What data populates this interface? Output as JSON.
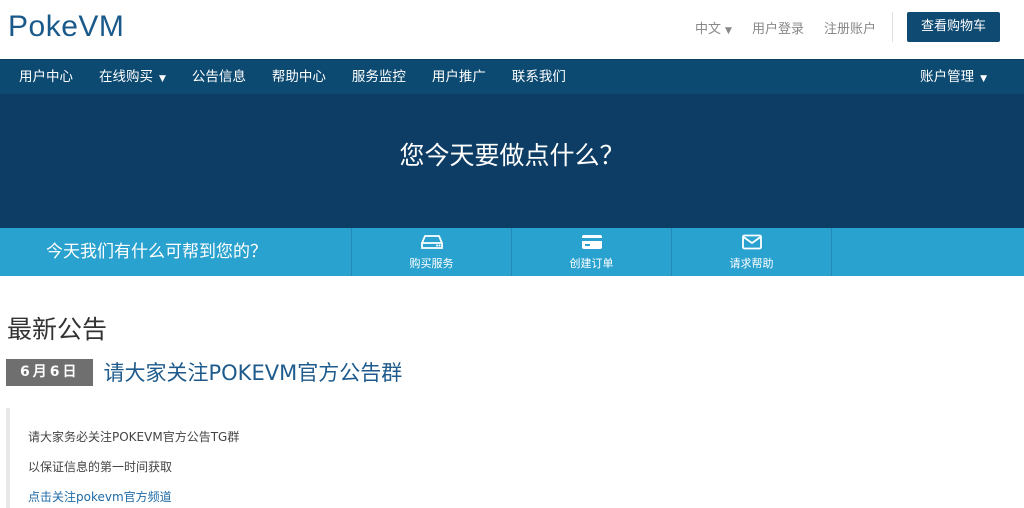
{
  "header": {
    "logo": "PokeVM",
    "language": "中文",
    "login": "用户登录",
    "register": "注册账户",
    "cart_button": "查看购物车"
  },
  "nav": {
    "items": [
      {
        "label": "用户中心"
      },
      {
        "label": "在线购买",
        "dropdown": true
      },
      {
        "label": "公告信息"
      },
      {
        "label": "帮助中心"
      },
      {
        "label": "服务监控"
      },
      {
        "label": "用户推广"
      },
      {
        "label": "联系我们"
      }
    ],
    "account": "账户管理"
  },
  "hero": {
    "title": "您今天要做点什么？"
  },
  "actions": {
    "prompt": "今天我们有什么可帮到您的？",
    "items": [
      {
        "label": "购买服务",
        "icon": "server-icon"
      },
      {
        "label": "创建订单",
        "icon": "credit-card-icon"
      },
      {
        "label": "请求帮助",
        "icon": "envelope-icon"
      }
    ]
  },
  "announcements": {
    "section_title": "最新公告",
    "latest": {
      "date": "6月6日",
      "title": "请大家关注POKEVM官方公告群",
      "line1": "请大家务必关注POKEVM官方公告TG群",
      "line2": "以保证信息的第一时间获取",
      "link": "点击关注pokevm官方频道"
    }
  },
  "colors": {
    "brand": "#1a5a8a",
    "nav_bg": "#0c4a72",
    "hero_bg": "#0d3d64",
    "action_bar_bg": "#2aa2cf",
    "date_badge_bg": "#6f6f6f"
  }
}
